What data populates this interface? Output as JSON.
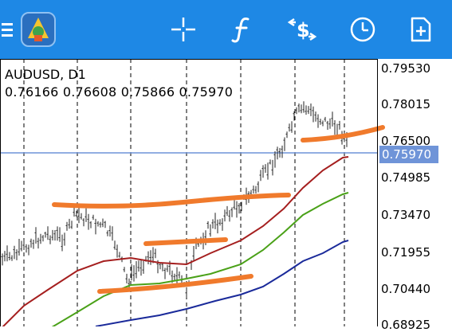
{
  "toolbar": {
    "items": [
      {
        "name": "menu-icon"
      },
      {
        "name": "app-logo"
      },
      {
        "name": "crosshair-icon"
      },
      {
        "name": "indicators-icon"
      },
      {
        "name": "trade-icon"
      },
      {
        "name": "timeframe-clock-icon"
      },
      {
        "name": "new-order-icon"
      }
    ],
    "background": "#1e88e5"
  },
  "chart": {
    "symbol_label": "AUDUSD, D1",
    "ohlc_label": "0.76166 0.76608 0.75866 0.75970",
    "current_price": "0.75970",
    "price_line_color": "#6f94d8",
    "y_ticks": [
      "0.79530",
      "0.78015",
      "0.76500",
      "0.74985",
      "0.73470",
      "0.71955",
      "0.70440",
      "0.68925"
    ]
  },
  "chart_data": {
    "type": "line",
    "title": "AUDUSD, D1",
    "ylim": [
      0.68925,
      0.7953
    ],
    "grid": "vertical dashed",
    "series": [
      {
        "name": "",
        "color": "#a51f1f",
        "values": [
          0.694,
          0.701,
          0.707,
          0.712,
          0.716,
          0.717,
          0.716,
          0.715,
          0.716,
          0.72,
          0.724,
          0.729,
          0.736,
          0.744,
          0.751,
          0.759
        ]
      },
      {
        "name": "",
        "color": "#4aa118",
        "values": [
          0.686,
          0.692,
          0.698,
          0.703,
          0.706,
          0.707,
          0.709,
          0.711,
          0.715,
          0.719,
          0.725,
          0.731,
          0.738,
          0.744
        ]
      },
      {
        "name": "",
        "color": "#1a2a9a",
        "values": [
          0.689,
          0.691,
          0.693,
          0.695,
          0.697,
          0.7,
          0.703,
          0.707,
          0.711,
          0.716,
          0.722
        ]
      }
    ],
    "annotations": "hand-drawn orange support and resistance lines"
  }
}
